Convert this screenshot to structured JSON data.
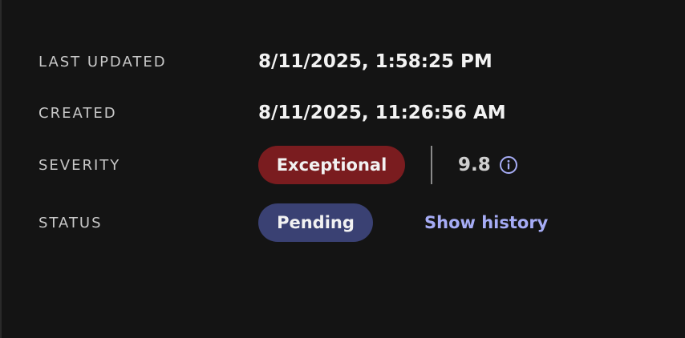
{
  "fields": {
    "last_updated": {
      "label": "LAST UPDATED",
      "value": "8/11/2025, 1:58:25 PM"
    },
    "created": {
      "label": "CREATED",
      "value": "8/11/2025, 11:26:56 AM"
    },
    "severity": {
      "label": "SEVERITY",
      "badge": "Exceptional",
      "badge_color": "#7a1c1f",
      "score": "9.8",
      "info_icon": "info-circle-icon"
    },
    "status": {
      "label": "STATUS",
      "badge": "Pending",
      "badge_color": "#3a4173",
      "link": "Show history",
      "link_color": "#a6acf5"
    }
  }
}
